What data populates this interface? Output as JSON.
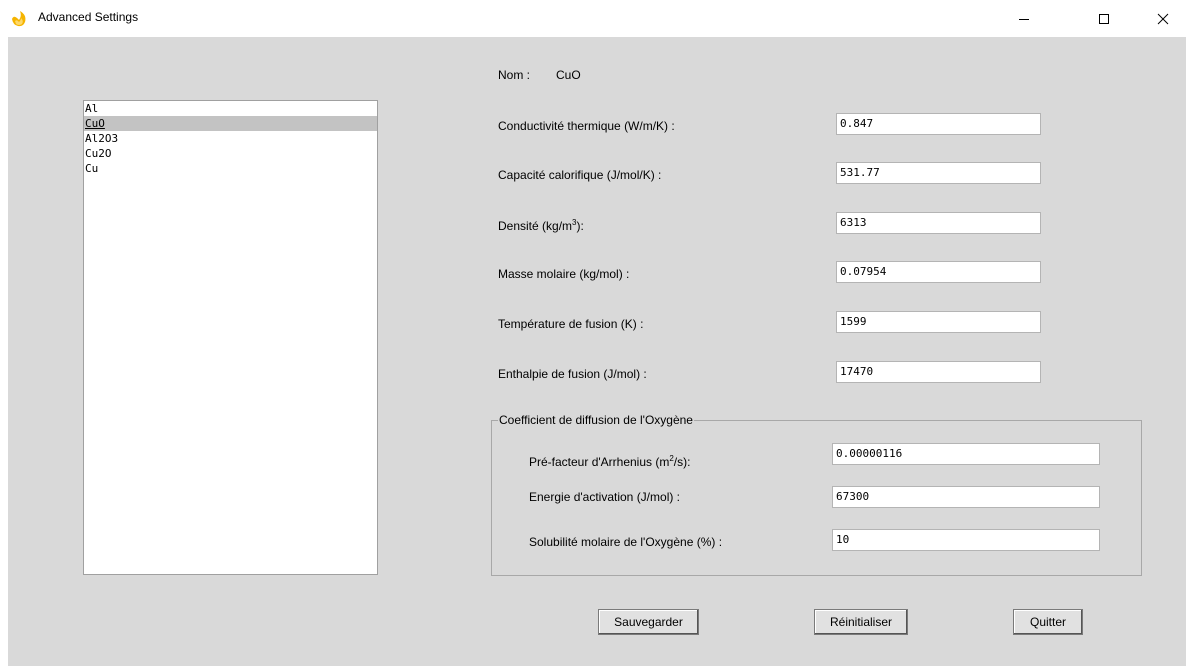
{
  "window": {
    "title": "Advanced Settings",
    "icon": "flame-icon"
  },
  "materials": {
    "items": [
      "Al",
      "CuO",
      "Al2O3",
      "Cu2O",
      "Cu"
    ],
    "selected": "CuO"
  },
  "form": {
    "nom_label": "Nom :",
    "nom_value": "CuO",
    "fields": [
      {
        "label": "Conductivité thermique (W/m/K) :",
        "value": "0.847"
      },
      {
        "label": "Capacité calorifique (J/mol/K) :",
        "value": "531.77"
      },
      {
        "label_prefix": "Densité (kg/m",
        "label_sup": "3",
        "label_suffix": "):",
        "value": "6313"
      },
      {
        "label": "Masse molaire (kg/mol) :",
        "value": "0.07954"
      },
      {
        "label": "Température de fusion (K) :",
        "value": "1599"
      },
      {
        "label": "Enthalpie de fusion (J/mol) :",
        "value": "17470"
      }
    ]
  },
  "oxygen": {
    "group_title": "Coefficient de diffusion de l'Oxygène",
    "fields": [
      {
        "label_prefix": "Pré-facteur d'Arrhenius (m",
        "label_sup": "2",
        "label_suffix": "/s):",
        "value": "0.00000116"
      },
      {
        "label": "Energie d'activation (J/mol) :",
        "value": "67300"
      },
      {
        "label": "Solubilité molaire de l'Oxygène (%) :",
        "value": "10"
      }
    ]
  },
  "buttons": {
    "save": "Sauvegarder",
    "reset": "Réinitialiser",
    "quit": "Quitter"
  }
}
